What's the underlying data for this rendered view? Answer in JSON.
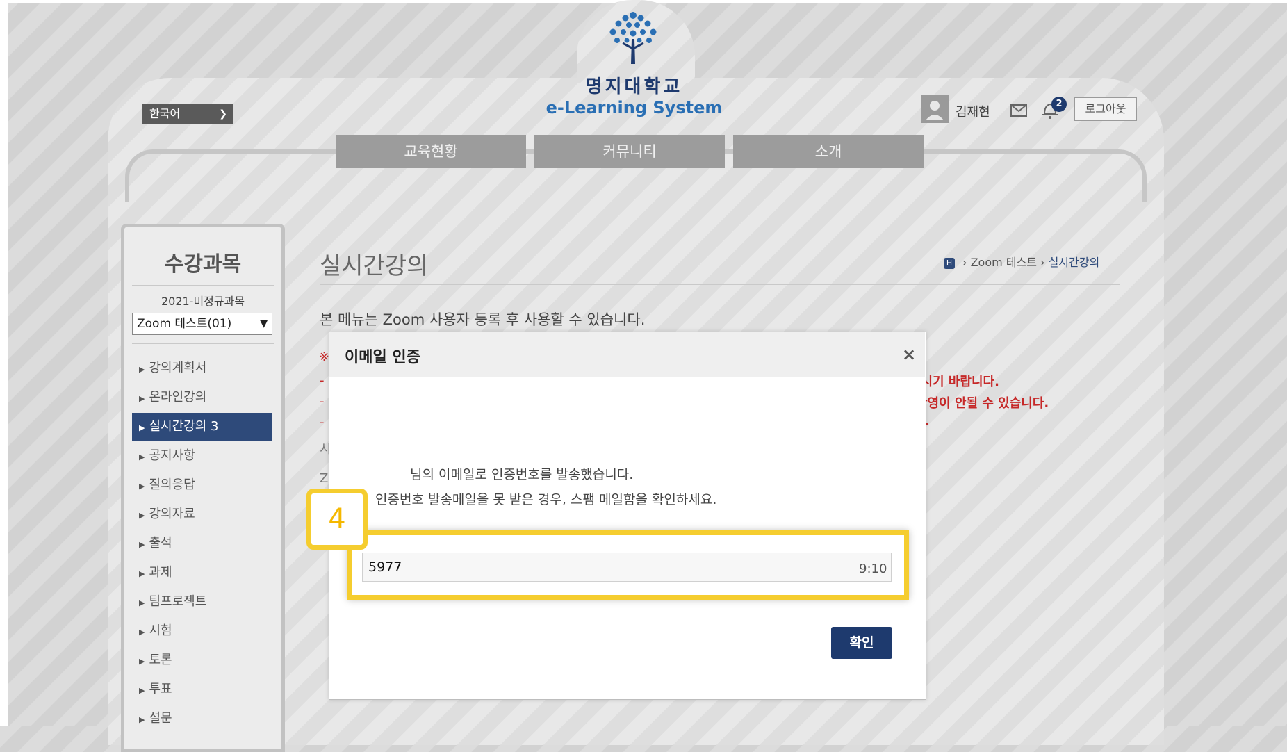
{
  "branding": {
    "university": "명지대학교",
    "system": "e-Learning System"
  },
  "header": {
    "language": "한국어",
    "user_name": "김재현",
    "notification_count": "2",
    "logout_label": "로그아웃"
  },
  "nav": {
    "tabs": [
      "교육현황",
      "커뮤니티",
      "소개"
    ]
  },
  "sidebar": {
    "title": "수강과목",
    "term": "2021-비정규과목",
    "course": "Zoom 테스트(01)",
    "items": [
      {
        "label": "강의계획서"
      },
      {
        "label": "온라인강의"
      },
      {
        "label": "실시간강의 3",
        "active": true
      },
      {
        "label": "공지사항"
      },
      {
        "label": "질의응답"
      },
      {
        "label": "강의자료"
      },
      {
        "label": "출석"
      },
      {
        "label": "과제"
      },
      {
        "label": "팀프로젝트"
      },
      {
        "label": "시험"
      },
      {
        "label": "토론"
      },
      {
        "label": "투표"
      },
      {
        "label": "설문"
      }
    ]
  },
  "main": {
    "page_title": "실시간강의",
    "breadcrumb": [
      "H",
      "Zoom 테스트",
      "실시간강의"
    ],
    "notice": "본 메뉴는 Zoom 사용자 등록 후 사용할 수 있습니다.",
    "partial_red_1": "-시기 바랍니다.",
    "partial_red_2": "반영이 안될 수 있습니다.",
    "frag_mark": "※",
    "frag_dash": "-",
    "frag_s": "시",
    "frag_z": "Z"
  },
  "modal": {
    "title": "이메일 인증",
    "close_label": "×",
    "message_1": "님의 이메일로 인증번호를 발송했습니다.",
    "message_2": "인증번호 발송메일을 못 받은 경우, 스팸 메일함을 확인하세요.",
    "code_value": "5977",
    "timer": "9:10",
    "confirm_label": "확인"
  },
  "annotation": {
    "step": "4",
    "color": "#f5cd2f"
  },
  "colors": {
    "brand_navy": "#1e3a6e",
    "brand_blue": "#2a6fb4",
    "active_nav": "#2e4a7a",
    "alert_red": "#c62828"
  }
}
